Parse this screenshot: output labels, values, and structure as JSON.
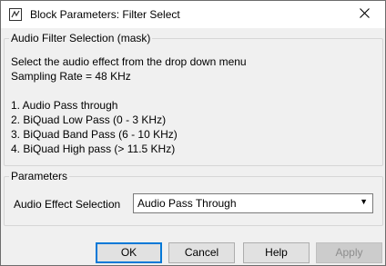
{
  "window": {
    "title": "Block Parameters: Filter Select"
  },
  "mask": {
    "group_title": "Audio Filter Selection (mask)",
    "lines": [
      "Select the audio effect from the drop down menu",
      "Sampling Rate = 48 KHz",
      "",
      "1. Audio Pass through",
      "2. BiQuad Low Pass (0 - 3 KHz)",
      "3. BiQuad Band Pass (6 - 10 KHz)",
      "4. BiQuad High pass (> 11.5 KHz)"
    ]
  },
  "parameters": {
    "group_title": "Parameters",
    "audio_effect_label": "Audio Effect Selection",
    "audio_effect_value": "Audio Pass Through"
  },
  "buttons": {
    "ok": "OK",
    "cancel": "Cancel",
    "help": "Help",
    "apply": "Apply"
  }
}
